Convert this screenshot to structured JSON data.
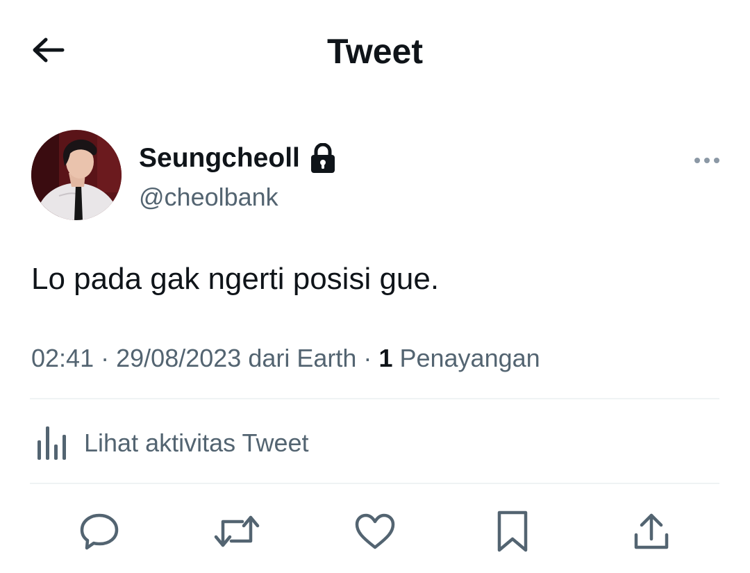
{
  "header": {
    "title": "Tweet"
  },
  "tweet": {
    "display_name": "Seungcheoll",
    "handle": "@cheolbank",
    "text": "Lo pada gak ngerti posisi gue.",
    "time": "02:41",
    "date": "29/08/2023",
    "source": "dari Earth",
    "views_count": "1",
    "views_label": "Penayangan",
    "separator": "·"
  },
  "activity": {
    "label": "Lihat aktivitas Tweet"
  },
  "icons": {
    "back": "arrow-left-icon",
    "lock": "lock-icon",
    "more": "more-horizontal-icon",
    "analytics": "bar-chart-icon",
    "reply": "reply-icon",
    "retweet": "retweet-icon",
    "like": "heart-icon",
    "bookmark": "bookmark-icon",
    "share": "share-icon"
  },
  "colors": {
    "text_primary": "#0f1419",
    "text_secondary": "#536471",
    "divider": "#eff3f4",
    "background": "#ffffff"
  }
}
